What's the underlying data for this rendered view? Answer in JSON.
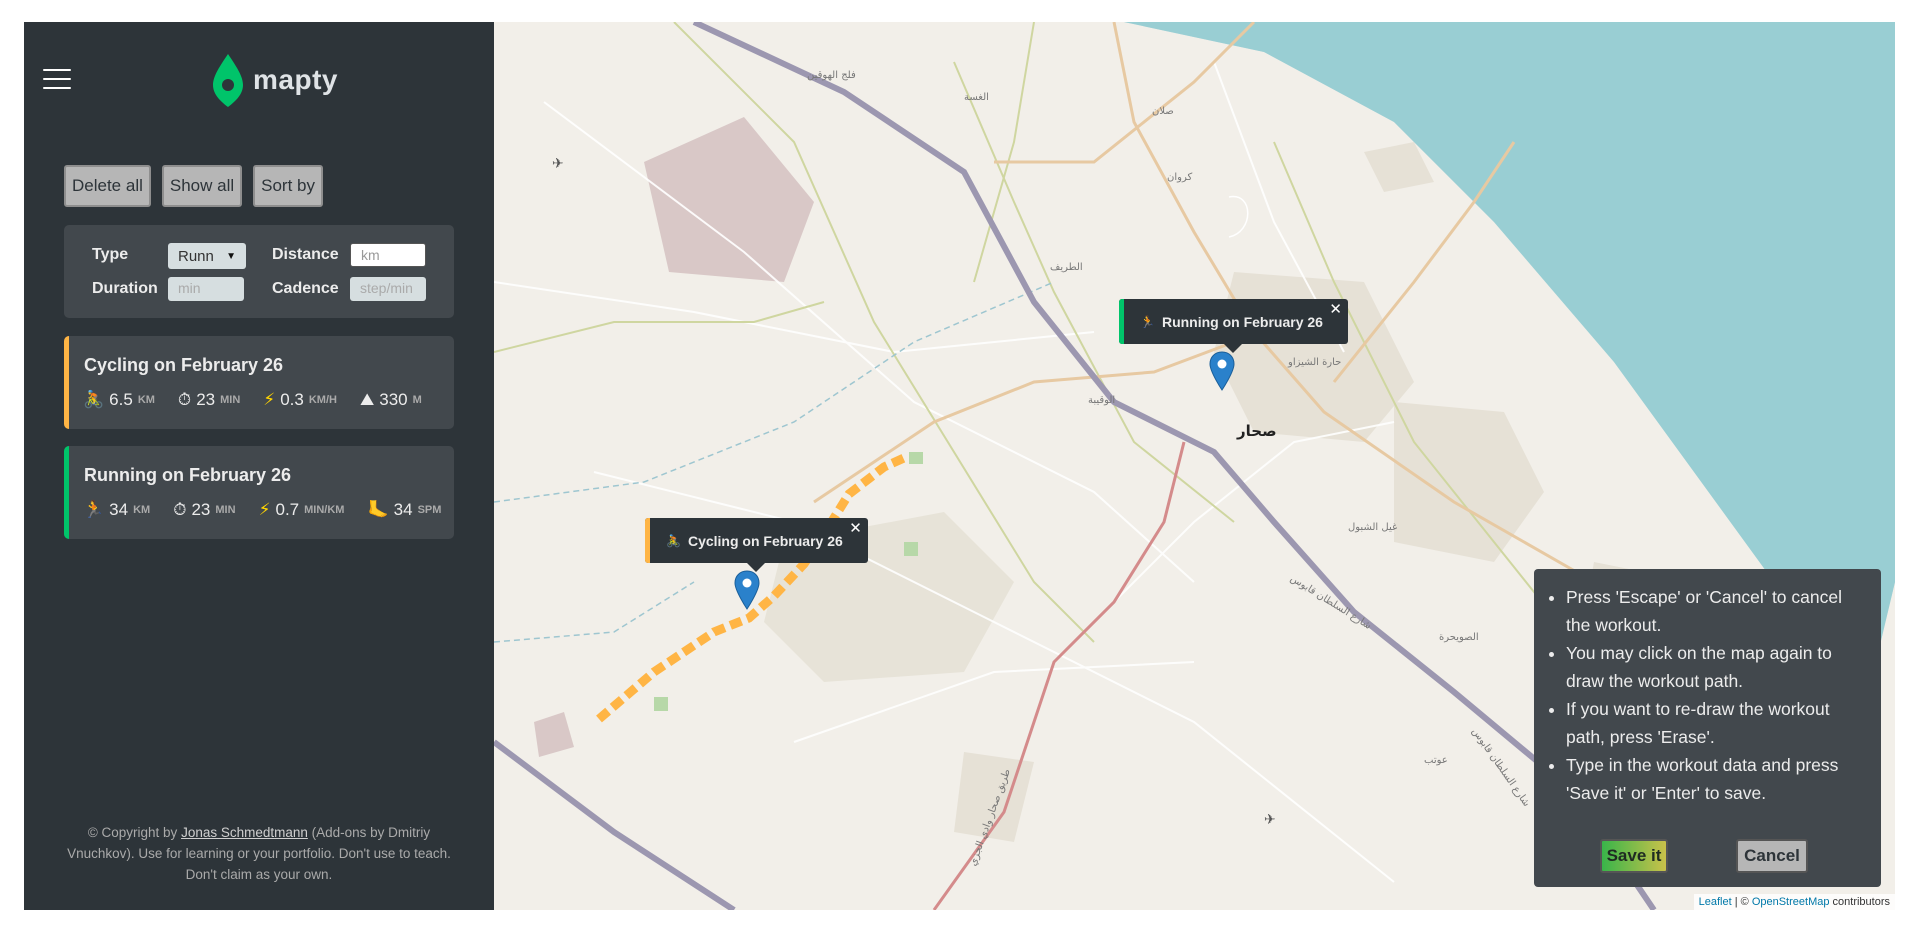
{
  "logo": {
    "text": "mapty",
    "brand_color": "#00c46a"
  },
  "buttons": {
    "delete_all": "Delete all",
    "show_all": "Show all",
    "sort_by": "Sort by"
  },
  "form": {
    "type_label": "Type",
    "type_value": "Runn",
    "distance_label": "Distance",
    "distance_placeholder": "km",
    "duration_label": "Duration",
    "duration_placeholder": "min",
    "cadence_label": "Cadence",
    "cadence_placeholder": "step/min"
  },
  "workouts": [
    {
      "title": "Cycling on February 26",
      "type": "cycling",
      "accent": "#ffb545",
      "details": [
        {
          "icon": "bike-icon",
          "glyph": "🚴",
          "value": "6.5",
          "unit": "km"
        },
        {
          "icon": "stopwatch-icon",
          "glyph": "⏱",
          "value": "23",
          "unit": "min"
        },
        {
          "icon": "lightning-icon",
          "glyph": "⚡",
          "value": "0.3",
          "unit": "km/h"
        },
        {
          "icon": "mountain-icon",
          "glyph": "⛰",
          "value": "330",
          "unit": "m"
        }
      ]
    },
    {
      "title": "Running on February 26",
      "type": "running",
      "accent": "#00c46a",
      "details": [
        {
          "icon": "runner-icon",
          "glyph": "🏃",
          "value": "34",
          "unit": "km"
        },
        {
          "icon": "stopwatch-icon",
          "glyph": "⏱",
          "value": "23",
          "unit": "min"
        },
        {
          "icon": "lightning-icon",
          "glyph": "⚡",
          "value": "0.7",
          "unit": "min/km"
        },
        {
          "icon": "footprint-icon",
          "glyph": "🦶",
          "value": "34",
          "unit": "spm"
        }
      ]
    }
  ],
  "copyright": {
    "prefix": "© Copyright by ",
    "author": "Jonas Schmedtmann",
    "suffix": " (Add-ons by Dmitriy Vnuchkov). Use for learning or your portfolio. Don't use to teach. Don't claim as your own."
  },
  "map": {
    "popups": [
      {
        "text": "Running on February 26",
        "type": "running"
      },
      {
        "text": "Cycling on February 26",
        "type": "cycling"
      }
    ],
    "labels": [
      {
        "text": "فلج الهوقين"
      },
      {
        "text": "الغسة"
      },
      {
        "text": "صلان"
      },
      {
        "text": "كروان"
      },
      {
        "text": "الطريف"
      },
      {
        "text": "حارة الشيزاو"
      },
      {
        "text": "الوقيبة"
      },
      {
        "text": "صحار"
      },
      {
        "text": "غيل الشبول"
      },
      {
        "text": "الصويحرة"
      },
      {
        "text": "عوتب"
      },
      {
        "text": "شارع السلطان قابوس"
      },
      {
        "text": "شارع السلطان قابوس"
      },
      {
        "text": "طريق صحار وادي الجزي"
      }
    ],
    "attribution": {
      "leaflet": "Leaflet",
      "separator": " | © ",
      "osm": "OpenStreetMap",
      "suffix": " contributors"
    }
  },
  "instructions": {
    "items": [
      "Press 'Escape' or 'Cancel' to cancel the workout.",
      "You may click on the map again to draw the workout path.",
      "If you want to re-draw the workout path, press 'Erase'.",
      "Type in the workout data and press 'Save it' or 'Enter' to save."
    ],
    "save_label": "Save it",
    "cancel_label": "Cancel"
  }
}
